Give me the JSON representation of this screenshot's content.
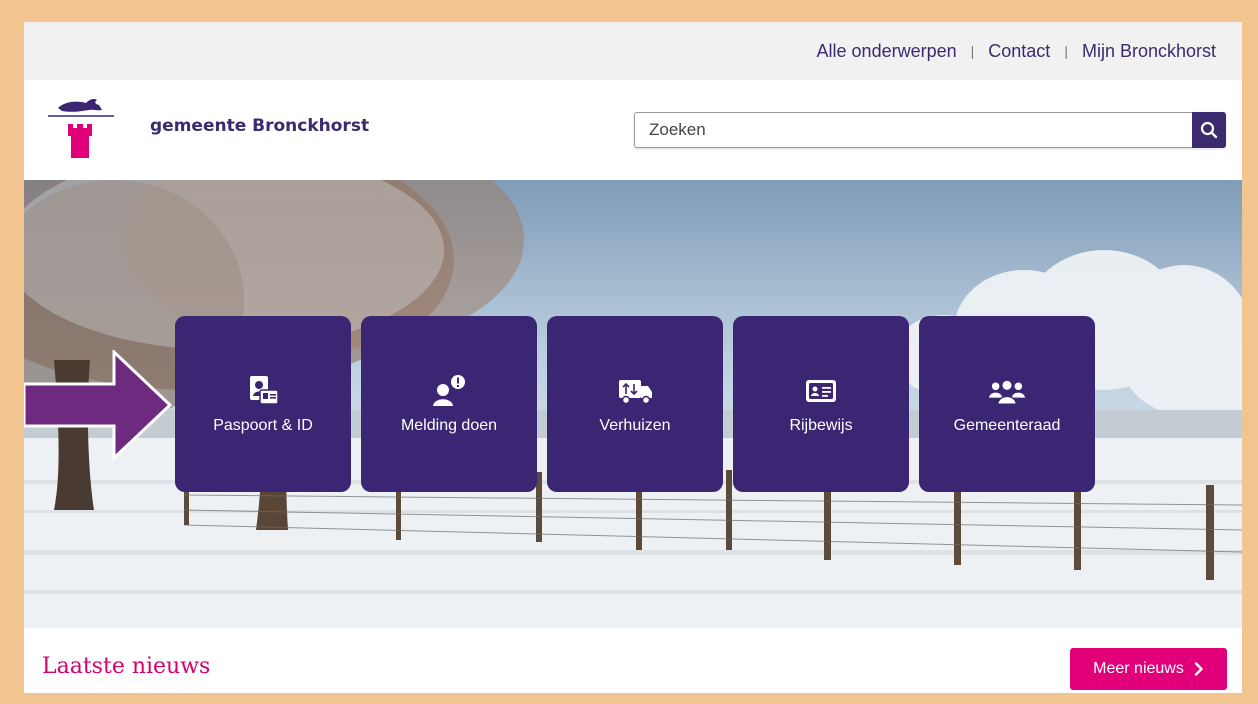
{
  "topnav": {
    "items": [
      "Alle onderwerpen",
      "Contact",
      "Mijn Bronckhorst"
    ],
    "separator": "|"
  },
  "header": {
    "brand": "gemeente Bronckhorst",
    "search_placeholder": "Zoeken"
  },
  "tiles": [
    {
      "label": "Paspoort & ID",
      "icon": "passport-id-icon"
    },
    {
      "label": "Melding doen",
      "icon": "report-icon"
    },
    {
      "label": "Verhuizen",
      "icon": "moving-truck-icon"
    },
    {
      "label": "Rijbewijs",
      "icon": "drivers-license-icon"
    },
    {
      "label": "Gemeenteraad",
      "icon": "council-icon"
    }
  ],
  "news": {
    "title": "Laatste nieuws",
    "more_label": "Meer nieuws"
  },
  "colors": {
    "primary": "#3a2673",
    "accent": "#e2007a",
    "frame": "#f2c48f",
    "annotation_arrow": "#6e2a7e"
  }
}
